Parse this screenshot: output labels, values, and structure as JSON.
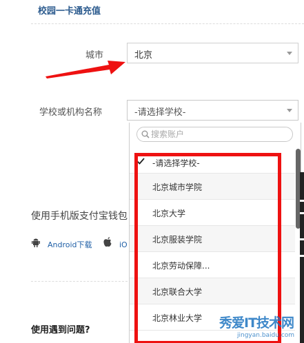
{
  "header": {
    "title": "校园一卡通充值"
  },
  "form": {
    "city_label": "城市",
    "city_value": "北京",
    "school_label": "学校或机构名称",
    "school_value": "-请选择学校-"
  },
  "dropdown": {
    "search_placeholder": "搜索账户",
    "options": [
      "-请选择学校-",
      "北京城市学院",
      "北京大学",
      "北京服装学院",
      "北京劳动保障...",
      "北京联合大学",
      "北京林业大学"
    ],
    "selected_index": 0
  },
  "app_section": {
    "text": "使用手机版支付宝钱包",
    "android_label": "Android下载",
    "ios_label": "iOS下载"
  },
  "help": {
    "title": "使用遇到问题?"
  },
  "watermark": {
    "text": "秀爱IT技术网",
    "sub": "jingyan.baidu.com"
  },
  "colors": {
    "annotation": "#ee1111",
    "link": "#1f5fa6",
    "title": "#2c5b8e"
  }
}
